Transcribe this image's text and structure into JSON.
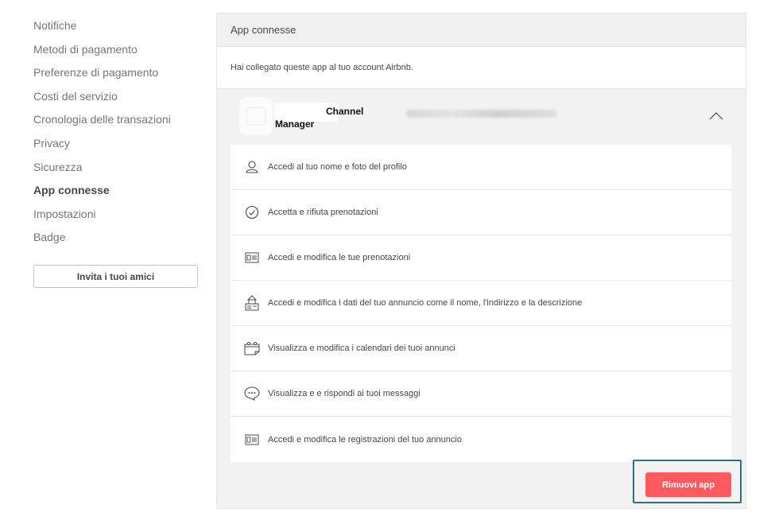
{
  "sidebar": {
    "items": [
      {
        "label": "Notifiche"
      },
      {
        "label": "Metodi di pagamento"
      },
      {
        "label": "Preferenze di pagamento"
      },
      {
        "label": "Costi del servizio"
      },
      {
        "label": "Cronologia delle transazioni"
      },
      {
        "label": "Privacy"
      },
      {
        "label": "Sicurezza"
      },
      {
        "label": "App connesse",
        "active": true
      },
      {
        "label": "Impostazioni"
      },
      {
        "label": "Badge"
      }
    ],
    "invite_label": "Invita i tuoi amici"
  },
  "panel": {
    "title": "App connesse",
    "description": "Hai collegato queste app al tuo account Airbnb.",
    "app": {
      "name_line1": "Channel",
      "name_line2": "Manager"
    },
    "permissions": [
      {
        "icon": "user-icon",
        "label": "Accedi al tuo nome e foto del profilo"
      },
      {
        "icon": "check-circle-icon",
        "label": "Accetta e rifiuta prenotazioni"
      },
      {
        "icon": "id-card-icon",
        "label": "Accedi e modifica le tue prenotazioni"
      },
      {
        "icon": "listing-icon",
        "label": "Accedi e modifica i dati del tuo annuncio come il nome, l'indirizzo e la descrizione"
      },
      {
        "icon": "calendar-icon",
        "label": "Visualizza e modifica i calendari dei tuoi annunci"
      },
      {
        "icon": "chat-icon",
        "label": "Visualizza e e rispondi ai tuoi messaggi"
      },
      {
        "icon": "id-card-icon",
        "label": "Accedi e modifica le registrazioni del tuo annuncio"
      }
    ],
    "remove_label": "Rimuovi app"
  },
  "colors": {
    "accent": "#ff5a5f",
    "focus_border": "#2e6e8e"
  }
}
